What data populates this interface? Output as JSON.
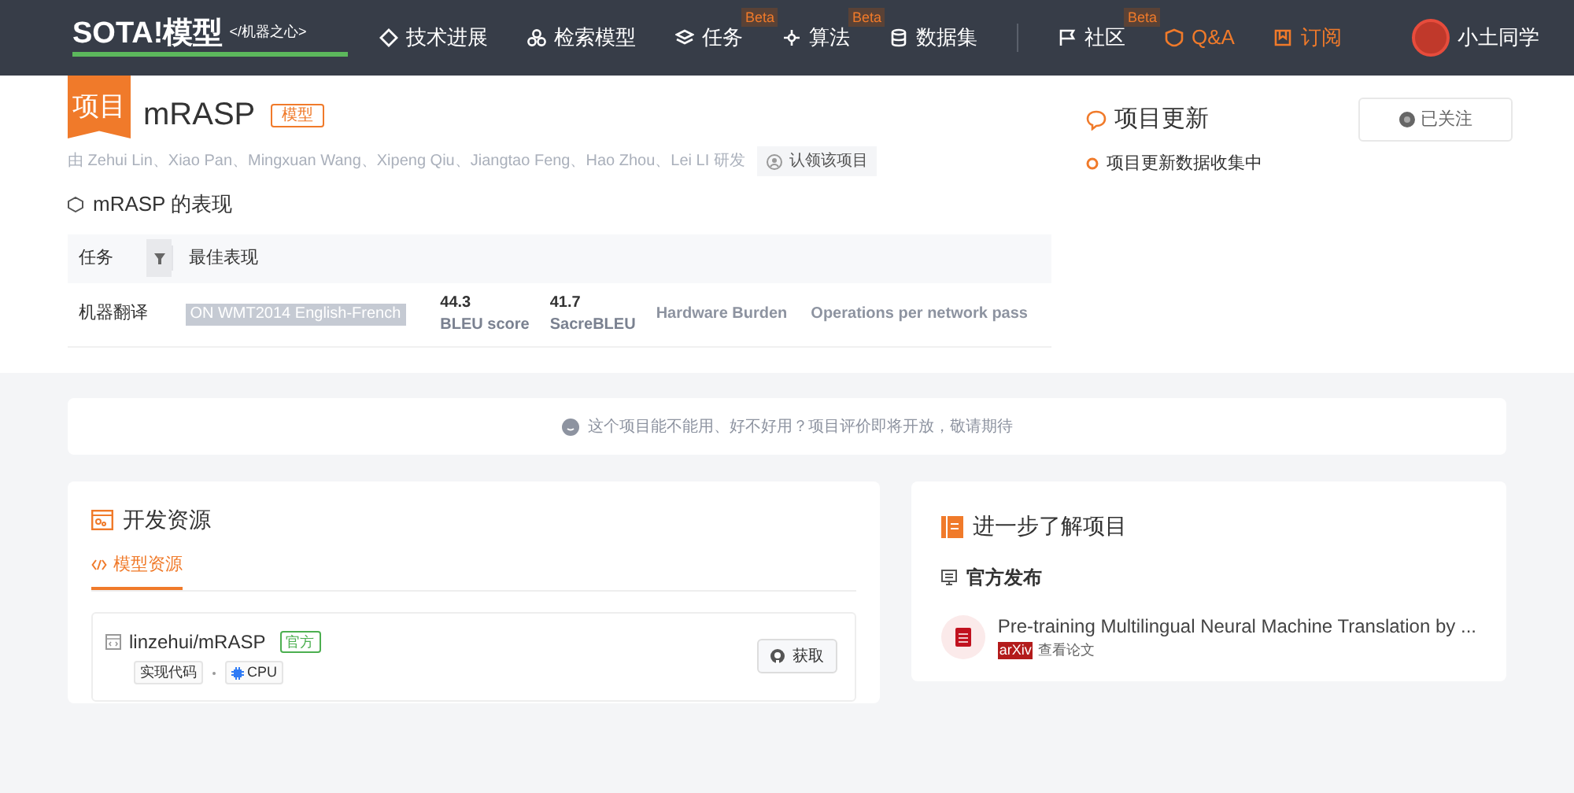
{
  "navbar": {
    "logo": "SOTA!模型",
    "logo_tag": "</机器之心>",
    "items": [
      {
        "label": "技术进展",
        "kind": "link"
      },
      {
        "label": "检索模型",
        "kind": "link"
      },
      {
        "label": "任务",
        "kind": "link",
        "badge": "Beta"
      },
      {
        "label": "算法",
        "kind": "link",
        "badge": "Beta"
      },
      {
        "label": "数据集",
        "kind": "link"
      },
      {
        "label": "社区",
        "kind": "link",
        "badge": "Beta"
      },
      {
        "label": "Q&A",
        "kind": "accent"
      },
      {
        "label": "订阅",
        "kind": "accent"
      }
    ],
    "user": "小土同学"
  },
  "project": {
    "corner": "项目",
    "title": "mRASP",
    "tag": "模型",
    "authors": "由 Zehui Lin、Xiao Pan、Mingxuan Wang、Xipeng Qiu、Jiangtao Feng、Hao Zhou、Lei LI 研发",
    "claim_button": "认领该项目"
  },
  "performance": {
    "title": "mRASP 的表现",
    "columns": [
      "任务",
      "最佳表现"
    ],
    "rows": [
      {
        "task": "机器翻译",
        "benchmark": "ON WMT2014 English-French",
        "metrics": [
          {
            "kind": "score",
            "value": "44.3",
            "label": "BLEU score"
          },
          {
            "kind": "score",
            "value": "41.7",
            "label": "SacreBLEU"
          },
          {
            "kind": "metric",
            "label": "Hardware Burden"
          },
          {
            "kind": "metric",
            "label": "Operations per network pass"
          }
        ]
      }
    ]
  },
  "updates": {
    "title": "项目更新",
    "follow_button": "已关注",
    "items": [
      "项目更新数据收集中"
    ]
  },
  "notice": "这个项目能不能用、好不好用？项目评价即将开放，敬请期待",
  "resources": {
    "title": "开发资源",
    "tabs": [
      {
        "label": "模型资源",
        "selected": true
      }
    ],
    "repos": [
      {
        "name": "linzehui/mRASP",
        "badge": "官方",
        "tags": [
          {
            "label": "实现代码",
            "kind": "plain"
          },
          {
            "label": "CPU",
            "kind": "cpu"
          }
        ],
        "button": "获取"
      }
    ]
  },
  "learn_more": {
    "title": "进一步了解项目",
    "section": "官方发布",
    "papers": [
      {
        "title": "Pre-training Multilingual Neural Machine Translation by ...",
        "source": "arXiv",
        "link": "查看论文"
      }
    ]
  }
}
